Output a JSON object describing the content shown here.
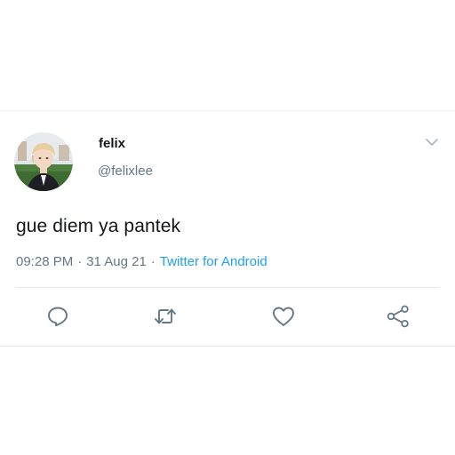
{
  "tweet": {
    "display_name": "felix",
    "username": "@felixlee",
    "text": "gue diem ya pantek",
    "time": "09:28 PM",
    "separator": "·",
    "date": "31 Aug 21",
    "source": "Twitter for Android"
  },
  "icons": {
    "menu": "chevron-down-icon",
    "reply": "reply-icon",
    "retweet": "retweet-icon",
    "like": "like-icon",
    "share": "share-icon"
  },
  "colors": {
    "accent": "#1da1f2",
    "text": "#14171a",
    "muted": "#657786",
    "icon": "#657786",
    "divider": "#e1e8ed"
  }
}
